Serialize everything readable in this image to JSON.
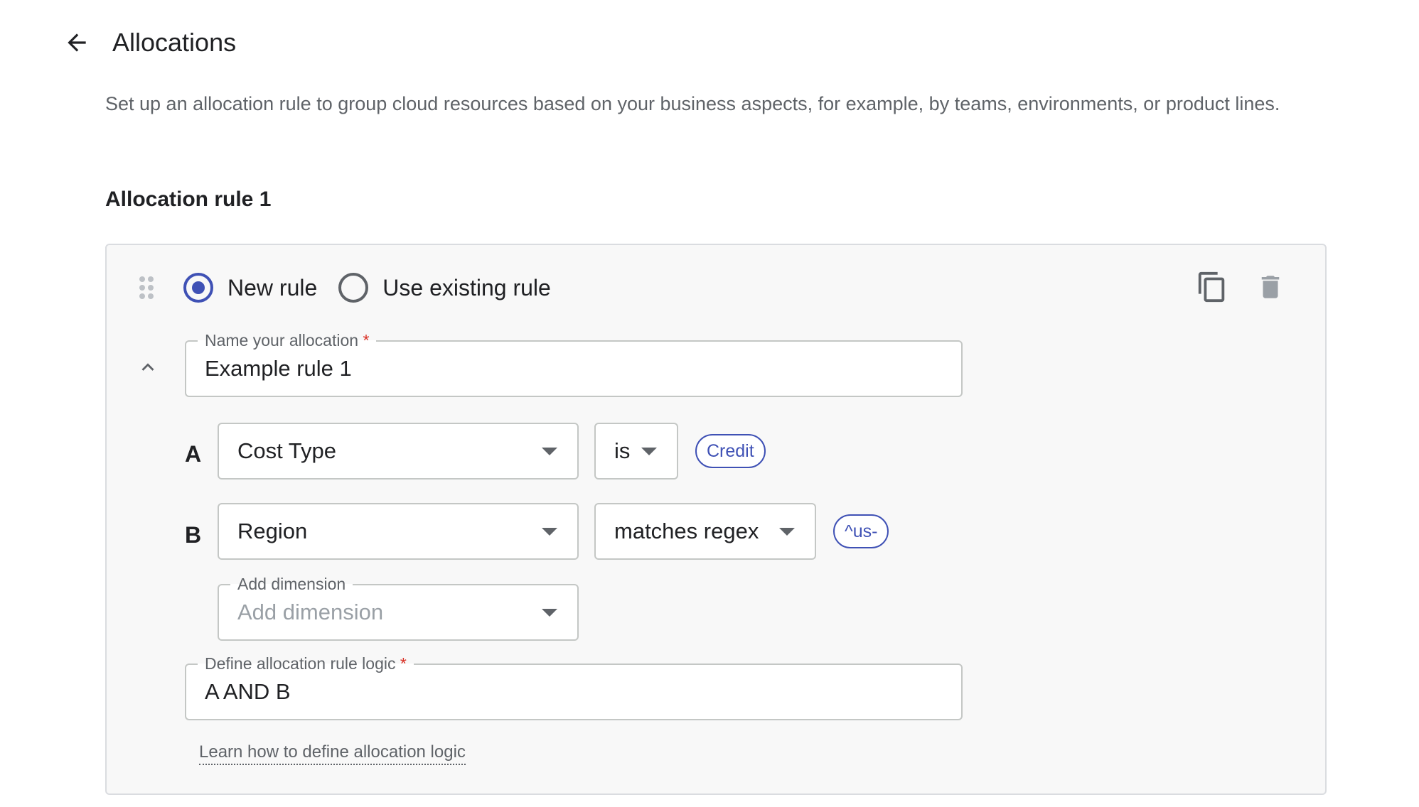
{
  "header": {
    "title": "Allocations",
    "back_icon": "arrow-left-icon"
  },
  "description": "Set up an allocation rule to group cloud resources based on your business aspects, for example, by teams, environments, or product lines.",
  "rule": {
    "heading": "Allocation rule 1",
    "mode_options": [
      {
        "label": "New rule",
        "selected": true
      },
      {
        "label": "Use existing rule",
        "selected": false
      }
    ],
    "actions": {
      "copy_icon": "copy-icon",
      "delete_icon": "trash-icon"
    },
    "name_field": {
      "label": "Name your allocation",
      "required_mark": "*",
      "value": "Example rule 1"
    },
    "conditions": [
      {
        "letter": "A",
        "dimension": "Cost Type",
        "operator": "is",
        "chip": "Credit"
      },
      {
        "letter": "B",
        "dimension": "Region",
        "operator": "matches regex",
        "chip": "^us-"
      }
    ],
    "add_dimension": {
      "label": "Add dimension",
      "placeholder": "Add dimension"
    },
    "logic_field": {
      "label": "Define allocation rule logic",
      "required_mark": "*",
      "value": "A AND B"
    },
    "learn_link": "Learn how to define allocation logic"
  },
  "colors": {
    "accent": "#3f51b5",
    "required": "#d93025",
    "card_bg": "#f8f8f8",
    "border": "#dadce0"
  }
}
